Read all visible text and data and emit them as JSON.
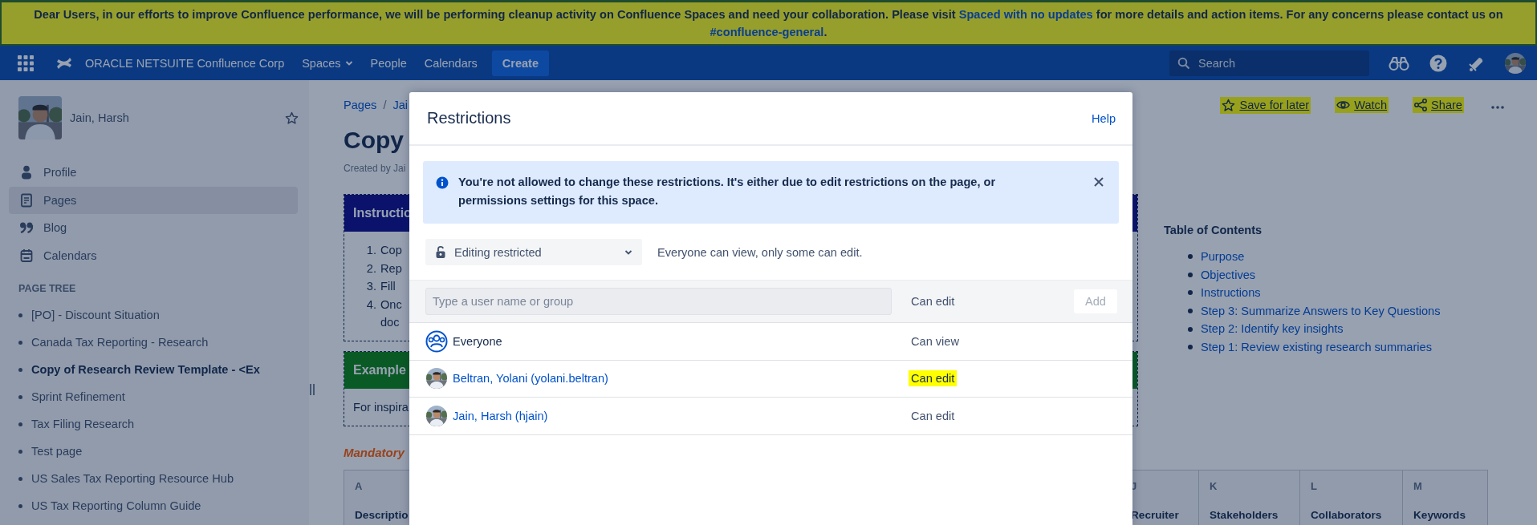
{
  "banner": {
    "parts": [
      {
        "kind": "text",
        "text": "Dear Users, in our efforts to improve Confluence performance, we will be performing cleanup activity on Confluence Spaces and need your collaboration. Please visit "
      },
      {
        "kind": "link",
        "text": "Spaced with no updates"
      },
      {
        "kind": "text",
        "text": " for more details and action items. For any concerns please contact us on "
      },
      {
        "kind": "link",
        "text": "#confluence-general"
      },
      {
        "kind": "text",
        "text": "."
      }
    ]
  },
  "header": {
    "site_name": "ORACLE NETSUITE Confluence Corp",
    "nav": [
      {
        "label": "Spaces",
        "kind": "dropdown"
      },
      {
        "label": "People",
        "kind": "link"
      },
      {
        "label": "Calendars",
        "kind": "link"
      }
    ],
    "create_button": "Create",
    "search": {
      "placeholder": "Search"
    }
  },
  "sidebar": {
    "user_name": "Jain, Harsh",
    "items": [
      {
        "label": "Profile",
        "kind": "profile",
        "selected": false
      },
      {
        "label": "Pages",
        "kind": "pages",
        "selected": true
      },
      {
        "label": "Blog",
        "kind": "blog",
        "selected": false
      },
      {
        "label": "Calendars",
        "kind": "calendars",
        "selected": false
      }
    ],
    "page_tree_heading": "PAGE TREE",
    "page_tree": [
      {
        "label": "[PO] - Discount Situation",
        "selected": false
      },
      {
        "label": "Canada Tax Reporting - Research",
        "selected": false
      },
      {
        "label": "Copy of Research Review Template - <Ex",
        "selected": true
      },
      {
        "label": "Sprint Refinement",
        "selected": false
      },
      {
        "label": "Tax Filing Research",
        "selected": false
      },
      {
        "label": "Test page",
        "selected": false
      },
      {
        "label": "US Sales Tax Reporting Resource Hub",
        "selected": false
      },
      {
        "label": "US Tax Reporting Column Guide",
        "selected": false
      }
    ]
  },
  "page": {
    "breadcrumbs": [
      "Pages",
      "/",
      "Jai"
    ],
    "title": "Copy",
    "byline": "Created by Jai",
    "actions": [
      {
        "label": "Save for later",
        "kind": "save",
        "highlighted": true
      },
      {
        "label": "Watch",
        "kind": "watch",
        "highlighted": true
      },
      {
        "label": "Share",
        "kind": "share",
        "highlighted": true
      }
    ],
    "instructions": {
      "heading": "Instructio",
      "items": [
        {
          "number": "1.",
          "lines": [
            "Cop"
          ]
        },
        {
          "number": "2.",
          "lines": [
            "Rep"
          ]
        },
        {
          "number": "3.",
          "lines": [
            "Fill"
          ]
        },
        {
          "number": "4.",
          "lines": [
            "Onc",
            "doc"
          ]
        }
      ]
    },
    "example": {
      "heading": "Example",
      "text": "For inspira"
    },
    "mandatory_label": "Mandatory",
    "toc": {
      "title": "Table of Contents",
      "items": [
        "Purpose",
        "Objectives",
        "Instructions",
        "Step 3: Summarize Answers to Key Questions",
        "Step 2: Identify key insights",
        "Step 1: Review existing research summaries"
      ]
    },
    "table": {
      "columns": [
        {
          "letter": "A",
          "label": "Descriptio"
        },
        {
          "letter": "J",
          "label": "Recruiter"
        },
        {
          "letter": "K",
          "label": "Stakeholders"
        },
        {
          "letter": "L",
          "label": "Collaborators"
        },
        {
          "letter": "M",
          "label": "Keywords"
        }
      ]
    }
  },
  "modal": {
    "title": "Restrictions",
    "help": "Help",
    "info": "You're not allowed to change these restrictions. It's either due to edit restrictions on the page, or permissions settings for this space.",
    "mode": {
      "value": "Editing restricted",
      "description": "Everyone can view, only some can edit."
    },
    "add_row": {
      "placeholder": "Type a user name or group",
      "permission": "Can edit",
      "add_button": {
        "label": "Add",
        "disabled": true
      }
    },
    "entries": [
      {
        "kind": "group",
        "name": "Everyone",
        "permission": "Can view",
        "highlighted": false
      },
      {
        "kind": "user",
        "name": "Beltran, Yolani (yolani.beltran)",
        "permission": "Can edit",
        "highlighted": true
      },
      {
        "kind": "user",
        "name": "Jain, Harsh (hjain)",
        "permission": "Can edit",
        "highlighted": false
      }
    ]
  }
}
